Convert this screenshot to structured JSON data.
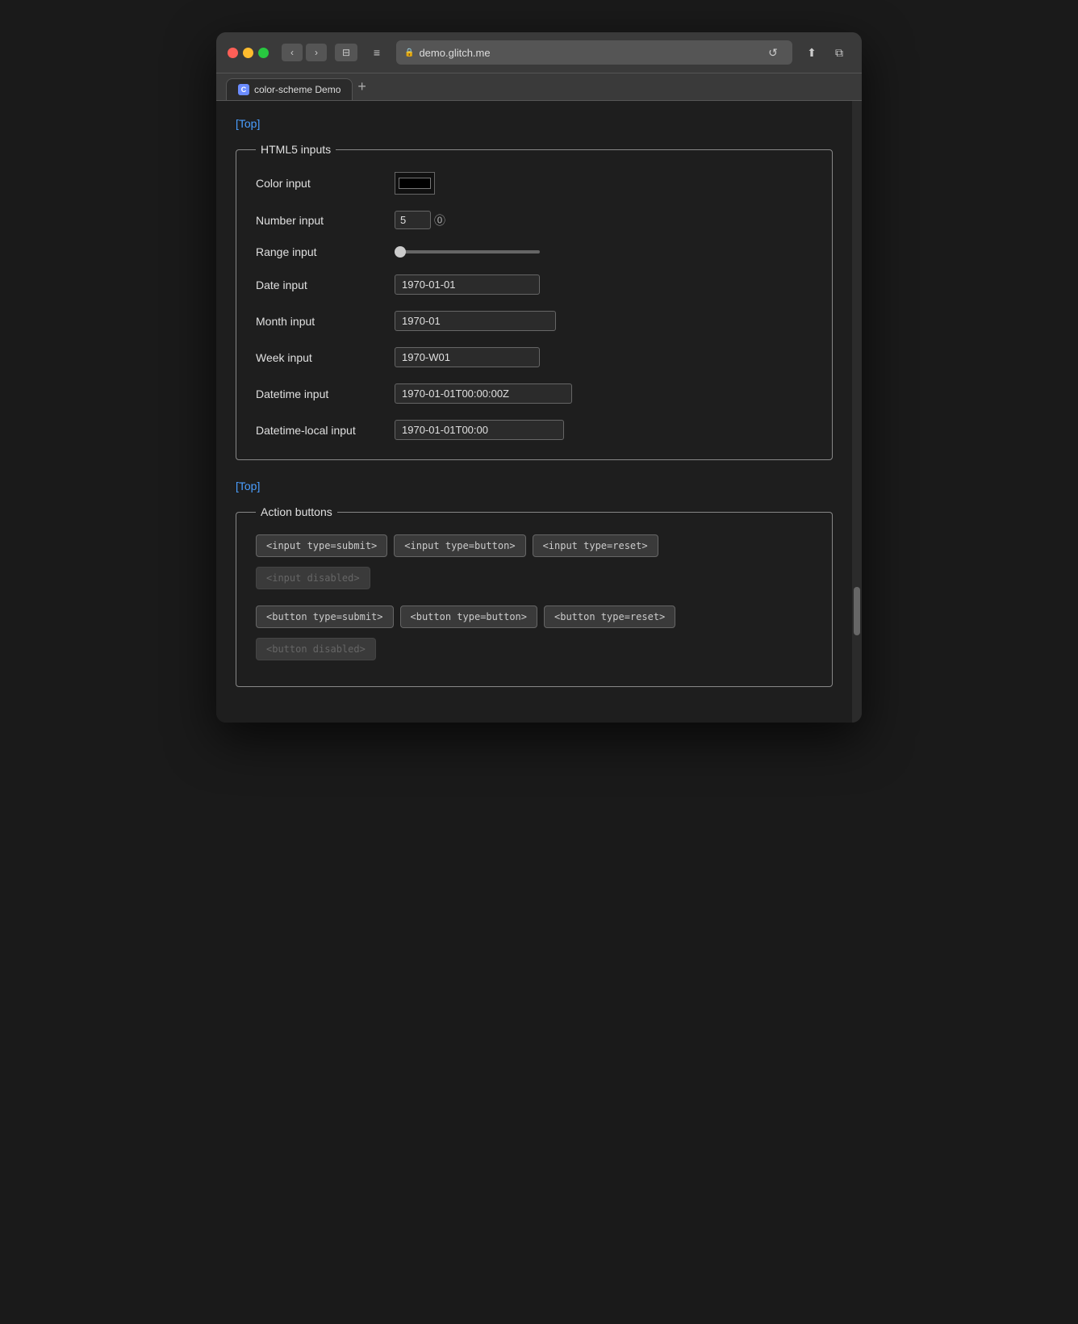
{
  "browser": {
    "url": "demo.glitch.me",
    "tab_title": "color-scheme Demo",
    "tab_favicon": "C"
  },
  "page": {
    "top_link": "[Top]",
    "top_link2": "[Top]"
  },
  "html5_section": {
    "legend": "HTML5 inputs",
    "color_label": "Color input",
    "color_value": "#000000",
    "number_label": "Number input",
    "number_value": "5",
    "range_label": "Range input",
    "range_value": "0",
    "date_label": "Date input",
    "date_value": "1970-01-01",
    "month_label": "Month input",
    "month_value": "1970-01",
    "week_label": "Week input",
    "week_value": "1970-W01",
    "datetime_label": "Datetime input",
    "datetime_value": "1970-01-01T00:00:00Z",
    "datetime_local_label": "Datetime-local input",
    "datetime_local_value": "1970-01-01T00:00"
  },
  "action_section": {
    "legend": "Action buttons",
    "input_submit_label": "<input type=submit>",
    "input_button_label": "<input type=button>",
    "input_reset_label": "<input type=reset>",
    "input_disabled_label": "<input disabled>",
    "button_submit_label": "<button type=submit>",
    "button_button_label": "<button type=button>",
    "button_reset_label": "<button type=reset>",
    "button_disabled_label": "<button disabled>"
  },
  "icons": {
    "back": "‹",
    "forward": "›",
    "sidebar": "⊟",
    "menu": "≡",
    "lock": "🔒",
    "reload": "↺",
    "share": "⬆",
    "newwindow": "⧉",
    "add": "+"
  }
}
